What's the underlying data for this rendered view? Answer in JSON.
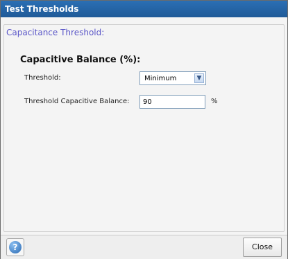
{
  "window": {
    "title": "Test Thresholds"
  },
  "group": {
    "legend": "Capacitance Threshold:"
  },
  "section": {
    "title": "Capacitive Balance (%):"
  },
  "threshold": {
    "label": "Threshold:",
    "selected": "Minimum"
  },
  "balance": {
    "label": "Threshold Capacitive Balance:",
    "value": "90",
    "unit": "%"
  },
  "footer": {
    "help_icon": "help-icon",
    "close_label": "Close"
  },
  "colors": {
    "titlebar": "#1f5a98",
    "legend": "#5b57c8"
  }
}
